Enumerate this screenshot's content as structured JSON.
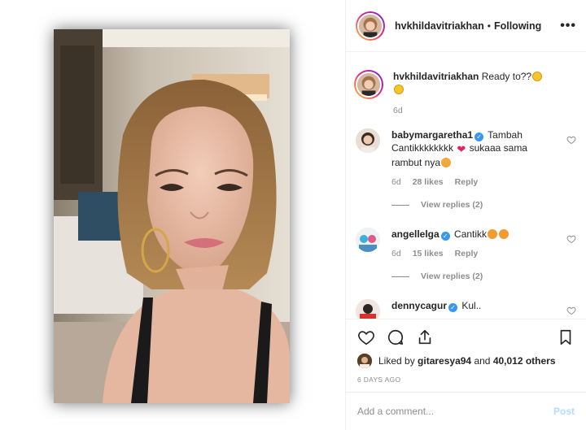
{
  "header": {
    "username": "hvkhildavitriakhan",
    "separator": "•",
    "follow_status": "Following",
    "more_icon": "•••"
  },
  "caption": {
    "username": "hvkhildavitriakhan",
    "text": "Ready to??",
    "time": "6d"
  },
  "comments": [
    {
      "username": "babymargaretha1",
      "verified": true,
      "text_part1": "Tambah Cantikkkkkkkk",
      "text_part2": "sukaaa sama rambut nya",
      "time": "6d",
      "likes": "28 likes",
      "reply": "Reply",
      "view_replies": "View replies (2)"
    },
    {
      "username": "angellelga",
      "verified": true,
      "text": "Cantikk",
      "time": "6d",
      "likes": "15 likes",
      "reply": "Reply",
      "view_replies": "View replies (2)"
    },
    {
      "username": "dennycagur",
      "verified": true,
      "text": "Kul.."
    }
  ],
  "actions": {
    "icons": [
      "heart-icon",
      "comment-icon",
      "share-icon",
      "bookmark-icon"
    ]
  },
  "likes": {
    "prefix": "Liked by",
    "user": "gitaresya94",
    "middle": "and",
    "others": "40,012 others"
  },
  "date": "6 DAYS AGO",
  "add_comment": {
    "placeholder": "Add a comment...",
    "post_label": "Post"
  },
  "colors": {
    "verified": "#3897f0",
    "post_disabled": "#b3dbff",
    "muted": "#8e8e8e",
    "story_ring": "#ee2a7b"
  }
}
